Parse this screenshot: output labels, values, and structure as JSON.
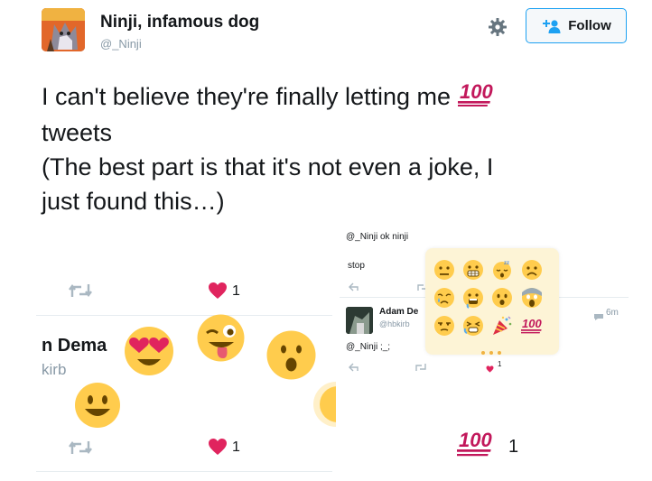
{
  "header": {
    "display_name": "Ninji, infamous dog",
    "handle": "@_Ninji",
    "follow_label": "Follow"
  },
  "tweet": {
    "line1": "I can't believe they're finally letting me",
    "line2": "tweets",
    "line3": "(The best part is that it's not even a joke, I",
    "line4": "just found this…)"
  },
  "left_panel": {
    "like_count_1": "1",
    "partial_name": "n Dema",
    "partial_handle": "kirb",
    "like_count_2": "1"
  },
  "right_panel": {
    "reply_text": "@_Ninji ok ninji",
    "stop_text": "stop",
    "author_name": "Adam De",
    "author_handle": "@hbkirb",
    "timestamp": "6m",
    "tweet_text": "@_Ninji ;_;",
    "like_count": "1",
    "bottom_count": "1"
  },
  "colors": {
    "accent_blue": "#1da1f2",
    "heart_red": "#e0245e",
    "hundred_red": "#c2185b",
    "emoji_yellow": "#ffcc4d",
    "muted_grey": "#8899a6"
  },
  "icons": [
    "gear-icon",
    "add-user-icon",
    "retweet-icon",
    "heart-icon",
    "reply-icon",
    "hundred-points-emoji",
    "smiley-emoji"
  ]
}
